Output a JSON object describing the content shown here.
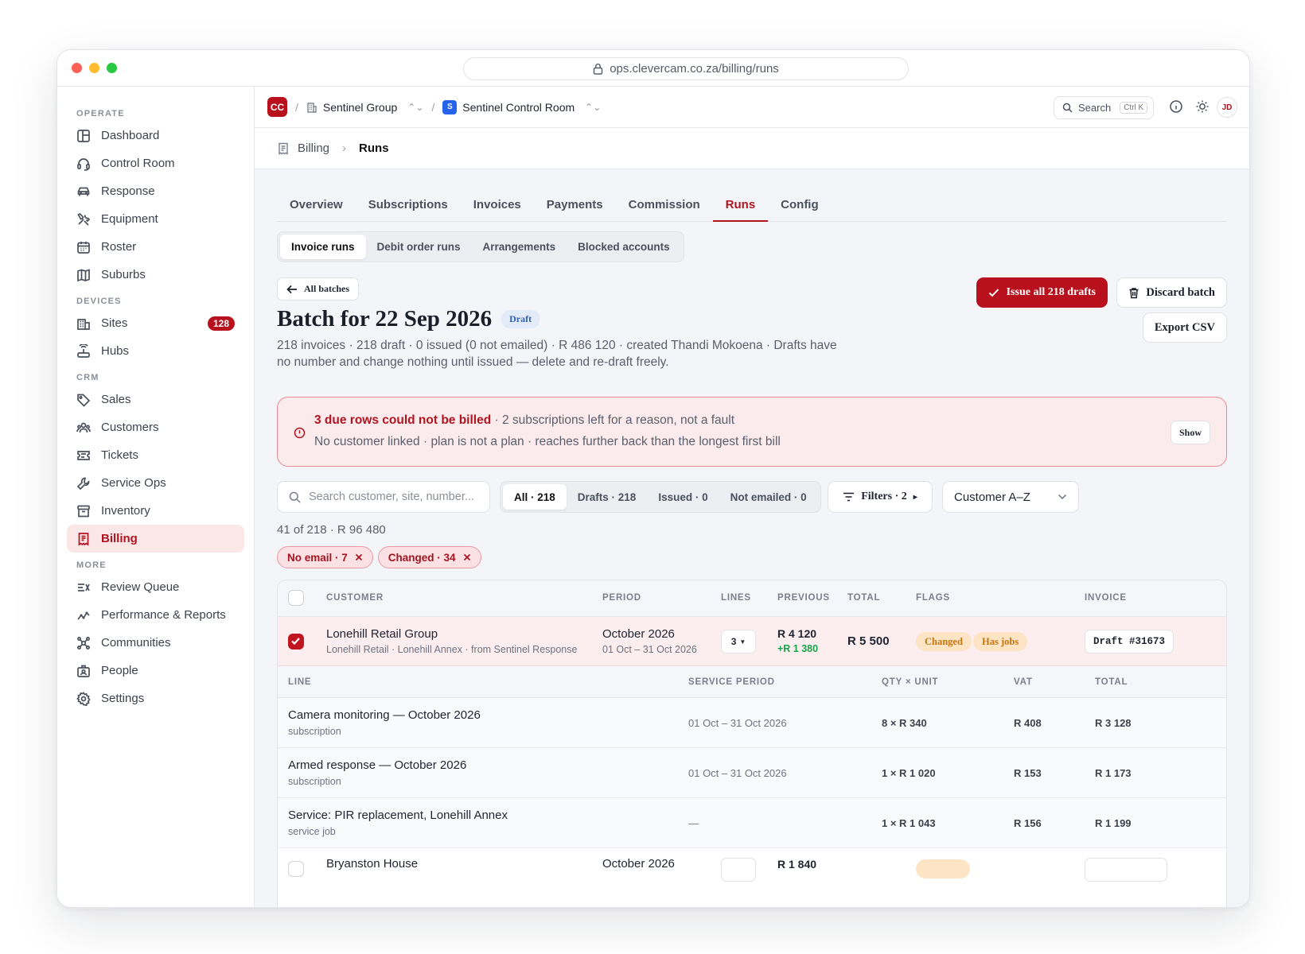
{
  "browser": {
    "url": "ops.clevercam.co.za/billing/runs"
  },
  "sidebar": {
    "sections": [
      {
        "label": "OPERATE",
        "items": [
          {
            "label": "Dashboard",
            "icon": "dashboard-icon"
          },
          {
            "label": "Control Room",
            "icon": "headset-icon"
          },
          {
            "label": "Response",
            "icon": "car-icon"
          },
          {
            "label": "Equipment",
            "icon": "tools-icon"
          },
          {
            "label": "Roster",
            "icon": "calendar-icon"
          },
          {
            "label": "Suburbs",
            "icon": "map-icon"
          }
        ]
      },
      {
        "label": "DEVICES",
        "items": [
          {
            "label": "Sites",
            "icon": "building-icon",
            "badge": "128"
          },
          {
            "label": "Hubs",
            "icon": "hub-icon"
          }
        ]
      },
      {
        "label": "CRM",
        "items": [
          {
            "label": "Sales",
            "icon": "tag-icon"
          },
          {
            "label": "Customers",
            "icon": "users-icon"
          },
          {
            "label": "Tickets",
            "icon": "ticket-icon"
          },
          {
            "label": "Service Ops",
            "icon": "wrench-icon"
          },
          {
            "label": "Inventory",
            "icon": "archive-icon"
          },
          {
            "label": "Billing",
            "icon": "receipt-icon",
            "active": true
          }
        ]
      },
      {
        "label": "MORE",
        "items": [
          {
            "label": "Review Queue",
            "icon": "review-icon"
          },
          {
            "label": "Performance & Reports",
            "icon": "chart-icon"
          },
          {
            "label": "Communities",
            "icon": "network-icon"
          },
          {
            "label": "People",
            "icon": "badge-icon"
          },
          {
            "label": "Settings",
            "icon": "gear-icon"
          }
        ]
      }
    ]
  },
  "topbar": {
    "logo": "CC",
    "org": "Sentinel Group",
    "workspace_logo": "S",
    "workspace": "Sentinel Control Room",
    "search_label": "Search",
    "search_kbd": "Ctrl K",
    "avatar": "JD"
  },
  "breadcrumb": {
    "parent": "Billing",
    "current": "Runs"
  },
  "tabs": [
    "Overview",
    "Subscriptions",
    "Invoices",
    "Payments",
    "Commission",
    "Runs",
    "Config"
  ],
  "active_tab": "Runs",
  "subtabs": [
    "Invoice runs",
    "Debit order runs",
    "Arrangements",
    "Blocked accounts"
  ],
  "batch": {
    "back_label": "All batches",
    "title": "Batch for 22 Sep 2026",
    "status": "Draft",
    "summary": "218 invoices · 218 draft · 0 issued (0 not emailed) · R 486 120 · created Thandi Mokoena · Drafts have no number and change nothing until issued — delete and re-draft freely.",
    "issue_label": "Issue all 218 drafts",
    "discard_label": "Discard batch",
    "export_label": "Export CSV"
  },
  "alert": {
    "title": "3 due rows could not be billed",
    "title_rest": " · 2 subscriptions left for a reason, not a fault",
    "detail": "No customer linked · plan is not a plan · reaches further back than the longest first bill",
    "show_label": "Show"
  },
  "filters": {
    "search_placeholder": "Search customer, site, number...",
    "segments": [
      "All · 218",
      "Drafts · 218",
      "Issued · 0",
      "Not emailed · 0"
    ],
    "filters_label": "Filters · 2",
    "sort_label": "Customer A–Z",
    "count": "41 of 218 · R 96 480",
    "chips": [
      "No email · 7",
      "Changed · 34"
    ]
  },
  "table": {
    "columns": [
      "CUSTOMER",
      "PERIOD",
      "LINES",
      "PREVIOUS",
      "TOTAL",
      "FLAGS",
      "INVOICE"
    ],
    "rows": [
      {
        "customer": "Lonehill Retail Group",
        "sites": "Lonehill Retail · Lonehill Annex · from Sentinel Response",
        "period": "October 2026",
        "period_range": "01 Oct – 31 Oct 2026",
        "lines": "3",
        "previous": "R 4 120",
        "delta": "+R 1 380",
        "total": "R 5 500",
        "flags": [
          "Changed",
          "Has jobs"
        ],
        "invoice": "Draft #31673",
        "checked": true
      },
      {
        "customer": "Bryanston House",
        "period": "October 2026",
        "previous": "R 1 840"
      }
    ],
    "line_columns": [
      "LINE",
      "SERVICE PERIOD",
      "QTY × UNIT",
      "VAT",
      "TOTAL"
    ],
    "lines": [
      {
        "name": "Camera monitoring — October 2026",
        "type": "subscription",
        "period": "01 Oct – 31 Oct 2026",
        "qty": "8 × R 340",
        "vat": "R 408",
        "total": "R 3 128"
      },
      {
        "name": "Armed response — October 2026",
        "type": "subscription",
        "period": "01 Oct – 31 Oct 2026",
        "qty": "1 × R 1 020",
        "vat": "R 153",
        "total": "R 1 173"
      },
      {
        "name": "Service: PIR replacement, Lonehill Annex",
        "type": "service job",
        "period": "—",
        "qty": "1 × R 1 043",
        "vat": "R 156",
        "total": "R 1 199"
      }
    ]
  }
}
